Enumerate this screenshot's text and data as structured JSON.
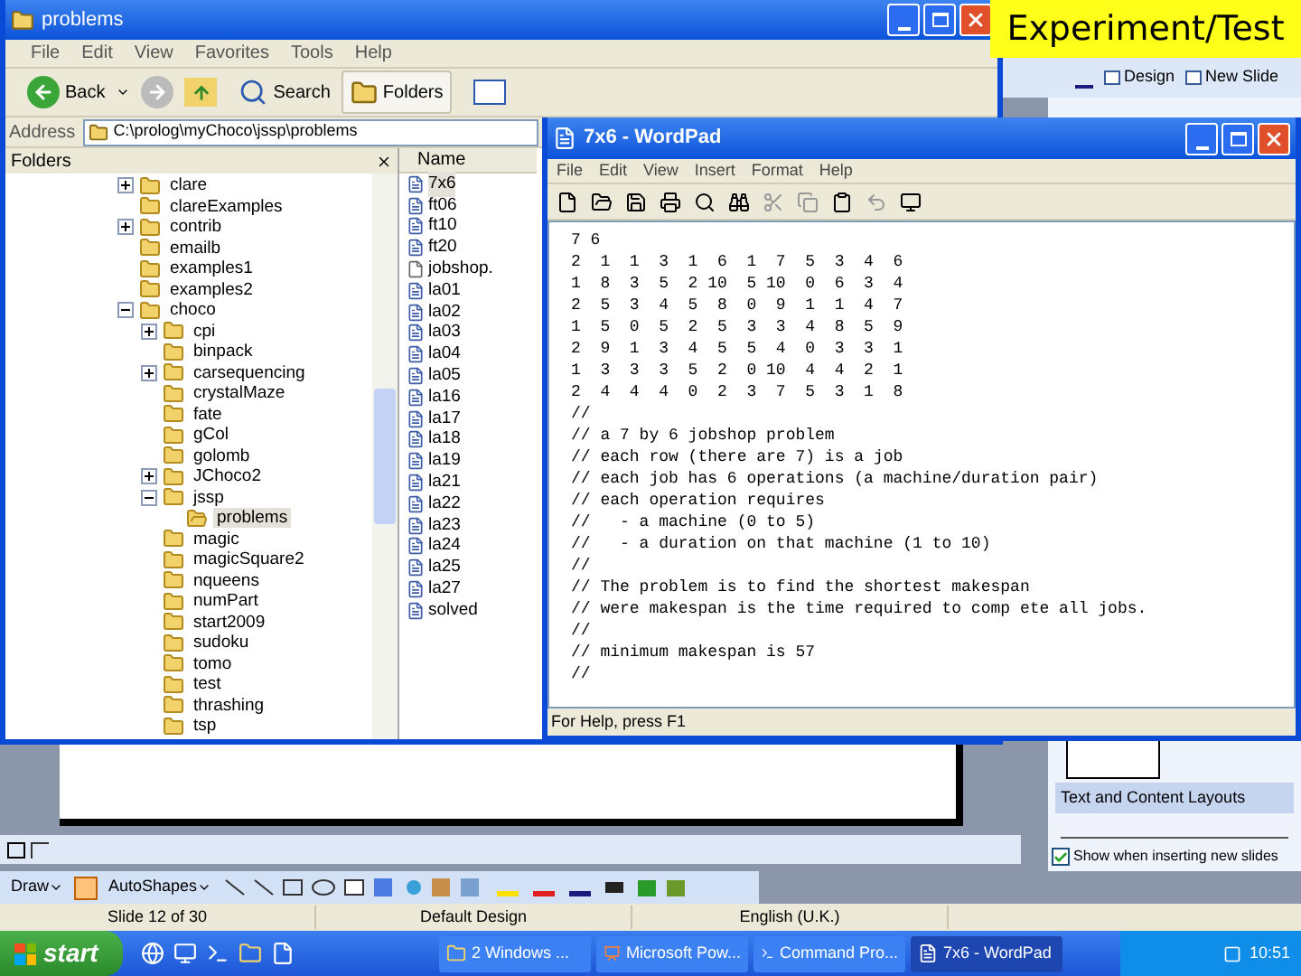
{
  "powerpoint": {
    "toolbar": [
      {
        "label": "Design"
      },
      {
        "label": "New Slide"
      }
    ],
    "task_pane": {
      "section_title": "Text and Content Layouts",
      "show_checkbox": {
        "label": "Show when inserting new slides",
        "checked": true
      }
    },
    "draw_toolbar": {
      "draw": "Draw",
      "autoshapes": "AutoShapes"
    },
    "status_bar": [
      "Slide 12 of 30",
      "Default Design",
      "English (U.K.)"
    ]
  },
  "explorer": {
    "title": "problems",
    "menu": [
      "File",
      "Edit",
      "View",
      "Favorites",
      "Tools",
      "Help"
    ],
    "toolbar": {
      "back": "Back",
      "search": "Search",
      "folders": "Folders"
    },
    "address_label": "Address",
    "address": "C:\\prolog\\myChoco\\jssp\\problems",
    "folders_title": "Folders",
    "name_column": "Name",
    "tree": [
      {
        "label": "clare",
        "expanded": false,
        "selected": false
      },
      {
        "label": "clareExamples",
        "selected": false
      },
      {
        "label": "contrib",
        "expanded": false,
        "selected": false
      },
      {
        "label": "emailb",
        "selected": false
      },
      {
        "label": "examples1",
        "selected": false
      },
      {
        "label": "examples2",
        "selected": false
      },
      {
        "label": "choco",
        "expanded": true,
        "selected": false,
        "children": [
          {
            "label": "cpi",
            "expanded": false,
            "selected": false
          },
          {
            "label": "binpack",
            "selected": false
          },
          {
            "label": "carsequencing",
            "expanded": false,
            "selected": false
          },
          {
            "label": "crystalMaze",
            "selected": false
          },
          {
            "label": "fate",
            "selected": false
          },
          {
            "label": "gCol",
            "selected": false
          },
          {
            "label": "golomb",
            "selected": false
          },
          {
            "label": "JChoco2",
            "expanded": false,
            "selected": false
          },
          {
            "label": "jssp",
            "expanded": true,
            "selected": false,
            "children": [
              {
                "label": "problems",
                "selected": true
              }
            ]
          },
          {
            "label": "magic",
            "selected": false
          },
          {
            "label": "magicSquare2",
            "selected": false
          },
          {
            "label": "nqueens",
            "selected": false
          },
          {
            "label": "numPart",
            "selected": false
          },
          {
            "label": "start2009",
            "selected": false
          },
          {
            "label": "sudoku",
            "selected": false
          },
          {
            "label": "tomo",
            "selected": false
          },
          {
            "label": "test",
            "selected": false
          },
          {
            "label": "thrashing",
            "selected": false
          },
          {
            "label": "tsp",
            "selected": false
          }
        ]
      }
    ],
    "files": [
      {
        "name": "7x6",
        "kind": "text",
        "selected": true
      },
      {
        "name": "ft06",
        "kind": "text",
        "selected": false
      },
      {
        "name": "ft10",
        "kind": "text",
        "selected": false
      },
      {
        "name": "ft20",
        "kind": "text",
        "selected": false
      },
      {
        "name": "jobshop.",
        "kind": "generic",
        "selected": false
      },
      {
        "name": "la01",
        "kind": "text",
        "selected": false
      },
      {
        "name": "la02",
        "kind": "text",
        "selected": false
      },
      {
        "name": "la03",
        "kind": "text",
        "selected": false
      },
      {
        "name": "la04",
        "kind": "text",
        "selected": false
      },
      {
        "name": "la05",
        "kind": "text",
        "selected": false
      },
      {
        "name": "la16",
        "kind": "text",
        "selected": false
      },
      {
        "name": "la17",
        "kind": "text",
        "selected": false
      },
      {
        "name": "la18",
        "kind": "text",
        "selected": false
      },
      {
        "name": "la19",
        "kind": "text",
        "selected": false
      },
      {
        "name": "la21",
        "kind": "text",
        "selected": false
      },
      {
        "name": "la22",
        "kind": "text",
        "selected": false
      },
      {
        "name": "la23",
        "kind": "text",
        "selected": false
      },
      {
        "name": "la24",
        "kind": "text",
        "selected": false
      },
      {
        "name": "la25",
        "kind": "text",
        "selected": false
      },
      {
        "name": "la27",
        "kind": "text",
        "selected": false
      },
      {
        "name": "solved",
        "kind": "text",
        "selected": false
      }
    ]
  },
  "wordpad": {
    "title": "7x6 - WordPad",
    "menu": [
      "File",
      "Edit",
      "View",
      "Insert",
      "Format",
      "Help"
    ],
    "lines": [
      "7 6",
      "2  1  1  3  1  6  1  7  5  3  4  6",
      "1  8  3  5  2 10  5 10  0  6  3  4",
      "2  5  3  4  5  8  0  9  1  1  4  7",
      "1  5  0  5  2  5  3  3  4  8  5  9",
      "2  9  1  3  4  5  5  4  0  3  3  1",
      "1  3  3  3  5  2  0 10  4  4  2  1",
      "2  4  4  4  0  2  3  7  5  3  1  8",
      "//",
      "// a 7 by 6 jobshop problem",
      "// each row (there are 7) is a job",
      "// each job has 6 operations (a machine/duration pair)",
      "// each operation requires",
      "//   - a machine (0 to 5)",
      "//   - a duration on that machine (1 to 10)",
      "//",
      "// The problem is to find the shortest makespan",
      "// were makespan is the time required to comp ete all jobs.",
      "//",
      "// minimum makespan is 57",
      "//"
    ],
    "status": "For Help, press F1"
  },
  "overlay_label": "Experiment/Test",
  "taskbar": {
    "start": "start",
    "tasks": [
      {
        "label": "2 Windows ...",
        "kind": "folder",
        "selected": false
      },
      {
        "label": "Microsoft Pow...",
        "kind": "powerpoint",
        "selected": false
      },
      {
        "label": "Command Pro...",
        "kind": "console",
        "selected": false
      },
      {
        "label": "7x6 - WordPad",
        "kind": "wordpad",
        "selected": true
      }
    ],
    "clock": "10:51"
  }
}
